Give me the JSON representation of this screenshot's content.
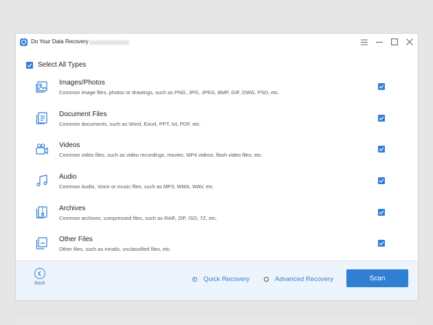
{
  "window": {
    "title": "Do Your Data Recovery",
    "controls": [
      "menu-icon",
      "minimize-icon",
      "maximize-icon",
      "close-icon"
    ]
  },
  "select_all": {
    "label": "Select All Types",
    "checked": true
  },
  "file_types": [
    {
      "title": "Images/Photos",
      "description": "Common image files, photos or drawings, such as PNG, JPG, JPEG, BMP, GIF, DWG, PSD, etc.",
      "icon": "image-icon",
      "checked": true
    },
    {
      "title": "Document Files",
      "description": "Common documents, such as Word, Excel, PPT, txt, PDF, etc.",
      "icon": "document-icon",
      "checked": true
    },
    {
      "title": "Videos",
      "description": "Common video files, such as video recordings, movies, MP4 videos, flash video files, etc.",
      "icon": "video-icon",
      "checked": true
    },
    {
      "title": "Audio",
      "description": "Common Audio, Voice or music files, such as MP3, WMA, WAV, etc.",
      "icon": "audio-icon",
      "checked": true
    },
    {
      "title": "Archives",
      "description": "Common archives, compressed files, such as RAR, ZIP, ISO, 7Z, etc.",
      "icon": "archive-icon",
      "checked": true
    },
    {
      "title": "Other Files",
      "description": "Other files, such as emails, unclassified files, etc.",
      "icon": "other-files-icon",
      "checked": true
    }
  ],
  "footer": {
    "back_label": "Back",
    "quick_recovery_label": "Quick Recovery",
    "advanced_recovery_label": "Advanced Recovery",
    "selected_mode": "Quick Recovery",
    "scan_label": "Scan"
  },
  "colors": {
    "accent": "#2f7fd3",
    "footer_bg": "#eef4fb",
    "page_bg": "#e6e6e6"
  }
}
